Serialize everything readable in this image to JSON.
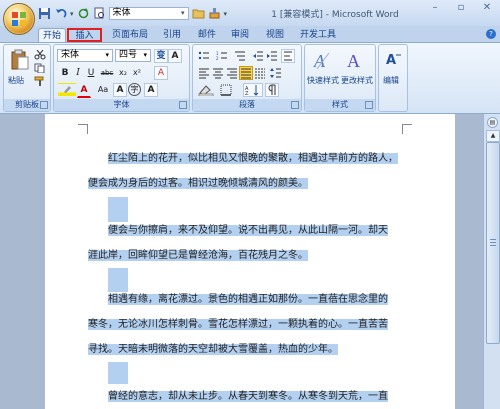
{
  "window": {
    "title": "1 [兼容模式] - Microsoft Word",
    "font_name": "宋体",
    "minimize": "–",
    "restore": "▫",
    "close": "✕"
  },
  "tabs": [
    {
      "label": "开始"
    },
    {
      "label": "插入"
    },
    {
      "label": "页面布局"
    },
    {
      "label": "引用"
    },
    {
      "label": "邮件"
    },
    {
      "label": "审阅"
    },
    {
      "label": "视图"
    },
    {
      "label": "开发工具"
    }
  ],
  "ribbon": {
    "clipboard": {
      "label": "剪贴板",
      "paste": "粘贴"
    },
    "font": {
      "label": "字体",
      "name": "宋体",
      "size": "四号",
      "bold": "B",
      "italic": "I",
      "underline": "U",
      "strike": "abc",
      "sub": "x₂",
      "sup": "x²",
      "case": "Aa",
      "grow": "A",
      "shrink": "A",
      "clear": "A"
    },
    "paragraph": {
      "label": "段落"
    },
    "styles": {
      "label": "样式",
      "quick": "快速样式",
      "change": "更改样式"
    },
    "editing": {
      "label": "编辑"
    }
  },
  "document": {
    "paragraphs": [
      [
        "红尘陌上的花开，似比相见又恨晚的聚散，相遇过早前方的路人，",
        "便会成为身后的过客。相识过晚倾城清风的颜美。"
      ],
      [
        "便会与你擦肩，来不及仰望。说不出再见，从此山隔一河。却天",
        "涯此岸，回眸仰望已是曾经沧海，百花残月之冬。"
      ],
      [
        "相遇有缘，离花漂过。景色的相遇正如那份。一直蓓在思念里的",
        "寒冬，无论冰川怎样刺骨。雪花怎样漂过，一颗执着的心。一直苦苦",
        "寻找。天暗未明微落的天空却被大雪覆盖，热血的少年。"
      ],
      [
        "曾经的意志，却从未止步。从春天到寒冬。从寒冬到天荒，一直"
      ]
    ]
  }
}
